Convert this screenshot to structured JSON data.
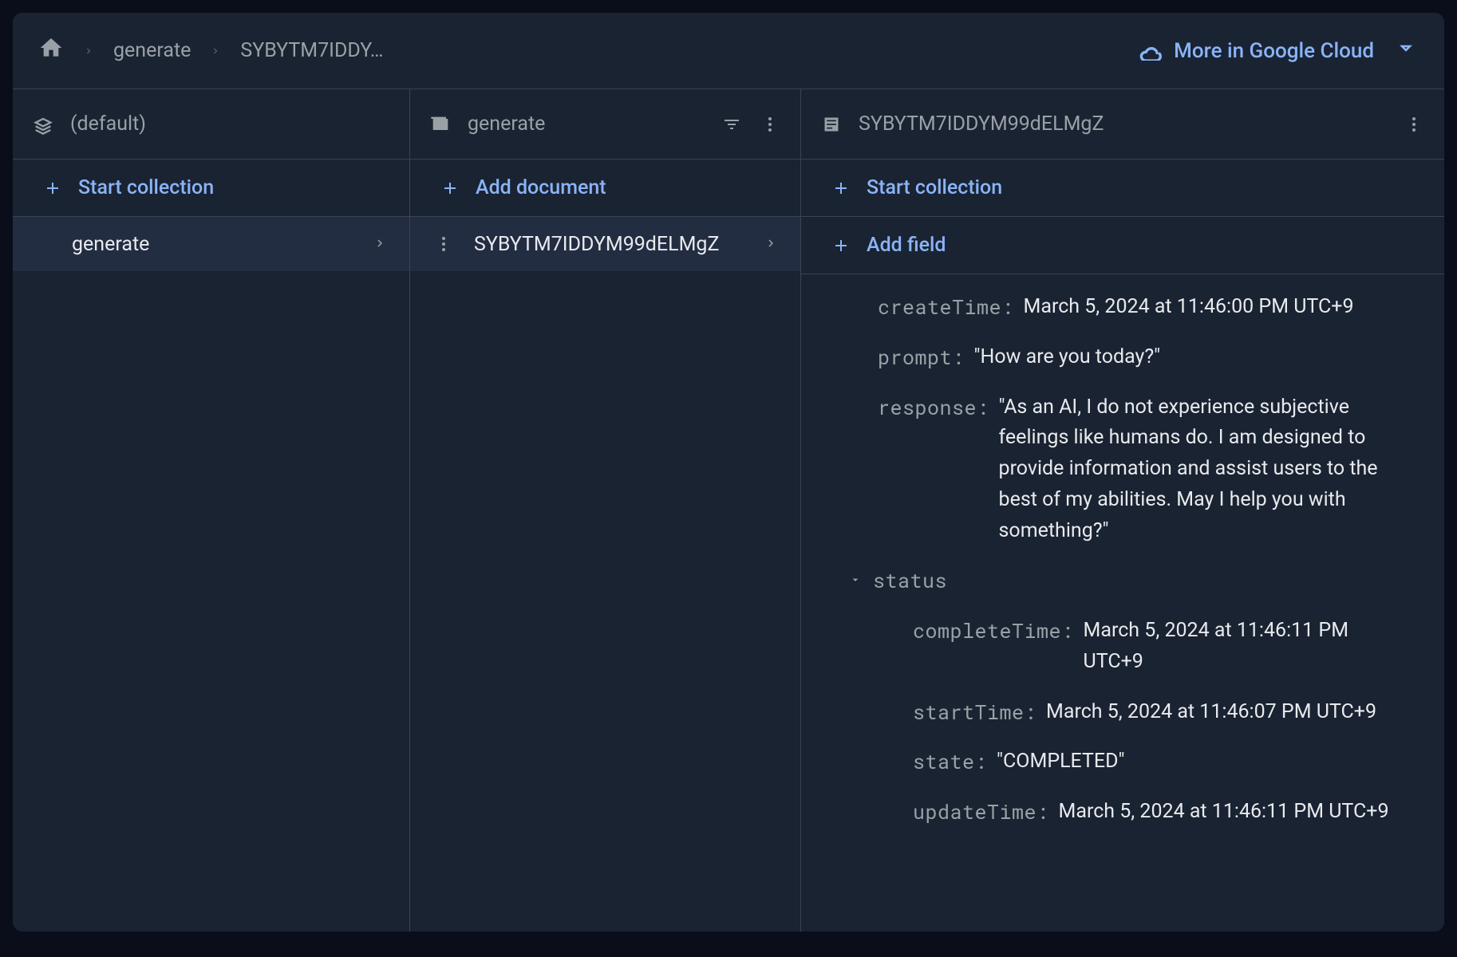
{
  "breadcrumb": {
    "items": [
      "generate",
      "SYBYTM7IDDY…"
    ]
  },
  "cloud_link": "More in Google Cloud",
  "panels": {
    "db": {
      "title": "(default)",
      "action": "Start collection",
      "items": [
        "generate"
      ]
    },
    "coll": {
      "title": "generate",
      "action": "Add document",
      "items": [
        "SYBYTM7IDDYM99dELMgZ"
      ]
    },
    "doc": {
      "title": "SYBYTM7IDDYM99dELMgZ",
      "action_collection": "Start collection",
      "action_field": "Add field",
      "fields": {
        "createTime": {
          "key": "createTime:",
          "value": "March 5, 2024 at 11:46:00 PM UTC+9"
        },
        "prompt": {
          "key": "prompt:",
          "value": "\"How are you today?\""
        },
        "response": {
          "key": "response:",
          "value": "\"As an AI, I do not experience subjective feelings like humans do. I am designed to provide information and assist users to the best of my abilities. May I help you with something?\""
        },
        "status": {
          "key": "status",
          "children": {
            "completeTime": {
              "key": "completeTime:",
              "value": "March 5, 2024 at 11:46:11 PM UTC+9"
            },
            "startTime": {
              "key": "startTime:",
              "value": "March 5, 2024 at 11:46:07 PM UTC+9"
            },
            "state": {
              "key": "state:",
              "value": "\"COMPLETED\""
            },
            "updateTime": {
              "key": "updateTime:",
              "value": "March 5, 2024 at 11:46:11 PM UTC+9"
            }
          }
        }
      }
    }
  }
}
